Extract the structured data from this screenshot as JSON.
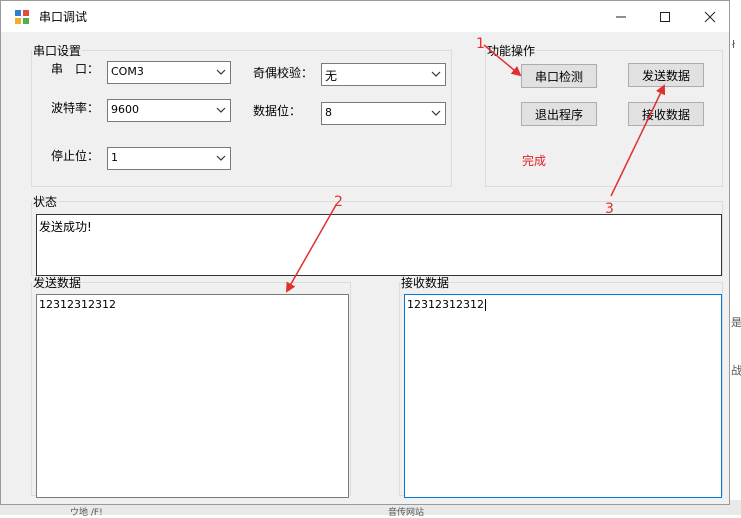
{
  "window": {
    "title": "串口调试",
    "minimize_glyph": "—",
    "maximize_glyph": "☐",
    "close_glyph": "✕"
  },
  "serial_settings": {
    "group_label": "串口设置",
    "port_label": "串　口：",
    "port_value": "COM3",
    "baud_label": "波特率：",
    "baud_value": "9600",
    "stopbits_label": "停止位：",
    "stopbits_value": "1",
    "parity_label": "奇偶校验：",
    "parity_value": "无",
    "databits_label": "数据位：",
    "databits_value": "8"
  },
  "function_ops": {
    "group_label": "功能操作",
    "detect_button": "串口检测",
    "send_button": "发送数据",
    "exit_button": "退出程序",
    "receive_button": "接收数据",
    "status_text": "完成"
  },
  "status": {
    "group_label": "状态",
    "message": "发送成功!"
  },
  "send_data": {
    "group_label": "发送数据",
    "content": "12312312312"
  },
  "receive_data": {
    "group_label": "接收数据",
    "content": "12312312312"
  },
  "annotations": {
    "marker_1": "1",
    "marker_2": "2",
    "marker_3": "3",
    "color": "#e03030"
  },
  "background_fragments": {
    "right_char_1": "ł",
    "right_char_2": "是",
    "right_char_3": "战",
    "bottom_text_1": "ウ地 /F!",
    "bottom_text_2": "音传网站"
  }
}
